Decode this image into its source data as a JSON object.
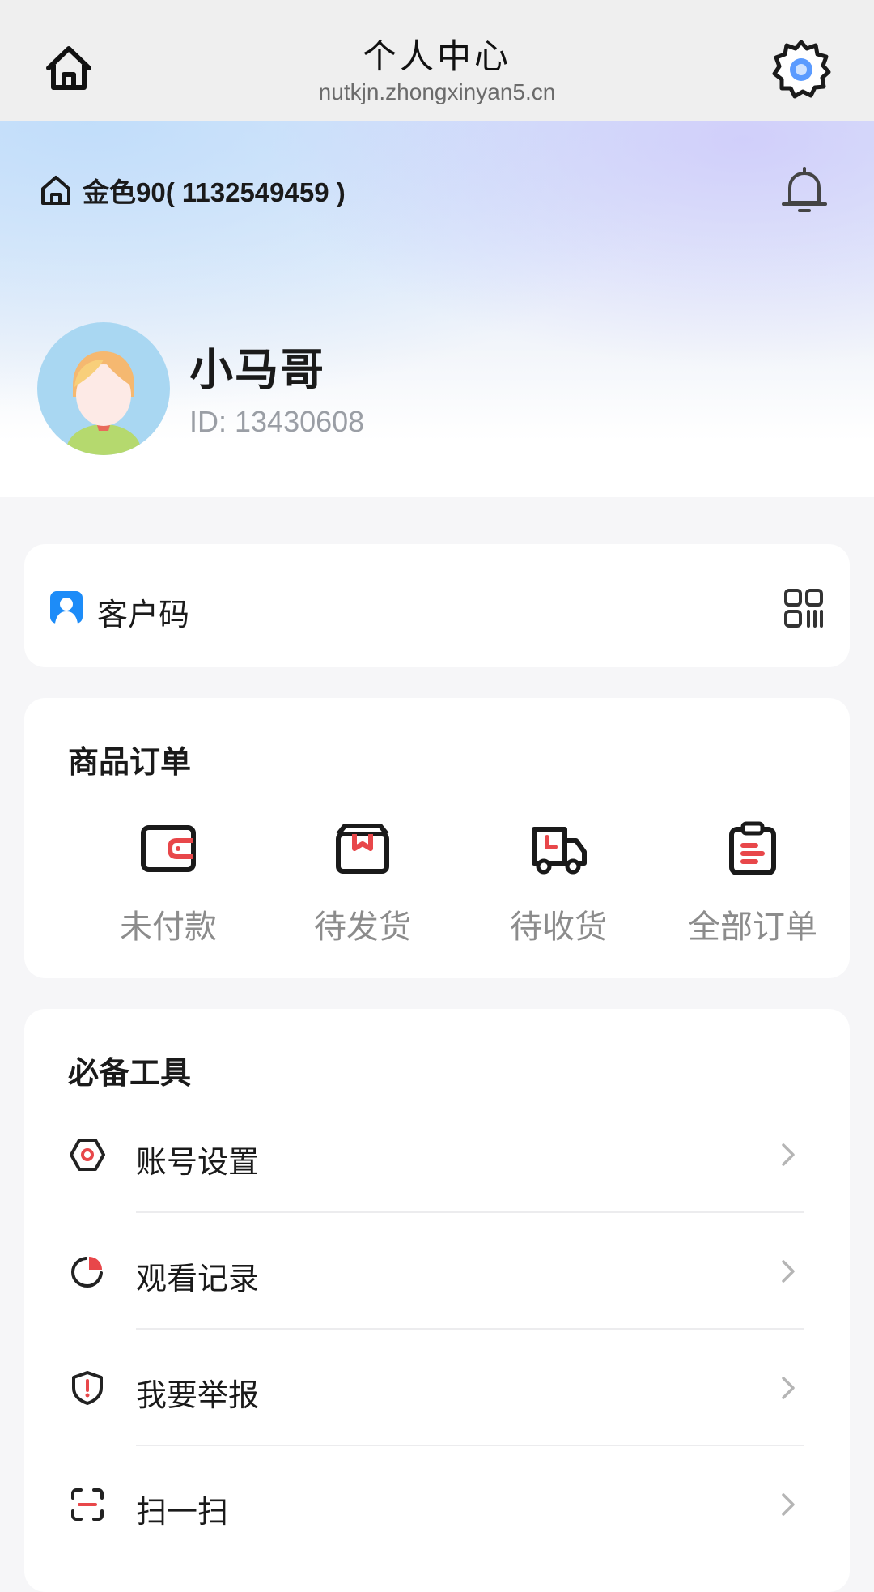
{
  "header": {
    "title": "个人中心",
    "subtitle": "nutkjn.zhongxinyan5.cn"
  },
  "store": {
    "name": "金色90( 1132549459 )"
  },
  "profile": {
    "name": "小马哥",
    "id_text": "ID: 13430608"
  },
  "customer_code": {
    "label": "客户码"
  },
  "orders": {
    "title": "商品订单",
    "items": [
      {
        "label": "未付款",
        "icon": "wallet-icon"
      },
      {
        "label": "待发货",
        "icon": "package-icon"
      },
      {
        "label": "待收货",
        "icon": "delivery-truck-icon"
      },
      {
        "label": "全部订单",
        "icon": "clipboard-icon"
      }
    ]
  },
  "tools": {
    "title": "必备工具",
    "items": [
      {
        "label": "账号设置",
        "icon": "hexagon-settings-icon"
      },
      {
        "label": "观看记录",
        "icon": "pie-history-icon"
      },
      {
        "label": "我要举报",
        "icon": "shield-alert-icon"
      },
      {
        "label": "扫一扫",
        "icon": "scan-icon"
      }
    ]
  },
  "colors": {
    "accent_red": "#e8474a",
    "icon_dark": "#222222",
    "code_blue": "#1d8cf8",
    "gear_blue": "#4a90ff"
  }
}
